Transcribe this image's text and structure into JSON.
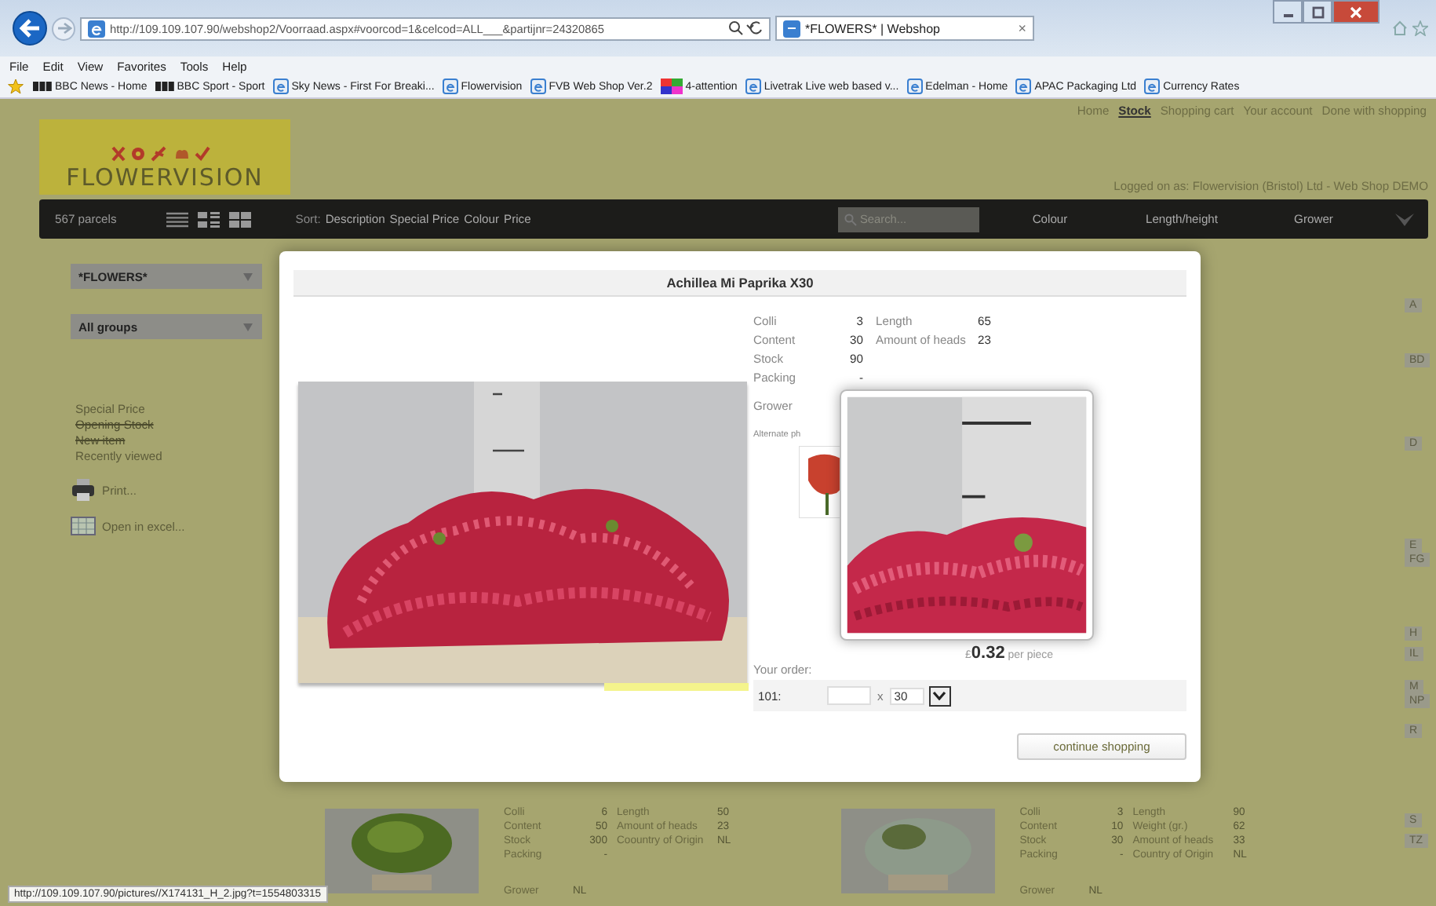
{
  "browser": {
    "address": "http://109.109.107.90/webshop2/Voorraad.aspx#voorcod=1&celcod=ALL___&partijnr=24320865",
    "tab": {
      "title": "*FLOWERS* | Webshop",
      "close": "×"
    },
    "menu": [
      "File",
      "Edit",
      "View",
      "Favorites",
      "Tools",
      "Help"
    ],
    "favorites": [
      {
        "kind": "bbc",
        "label": "BBC News - Home"
      },
      {
        "kind": "bbc",
        "label": "BBC Sport - Sport"
      },
      {
        "kind": "page",
        "label": "Sky News - First For Breaki..."
      },
      {
        "kind": "page",
        "label": "Flowervision"
      },
      {
        "kind": "page",
        "label": "FVB Web Shop Ver.2"
      },
      {
        "kind": "tiles",
        "label": "4-attention"
      },
      {
        "kind": "page",
        "label": "Livetrak  Live web based v..."
      },
      {
        "kind": "page",
        "label": "Edelman - Home"
      },
      {
        "kind": "page",
        "label": "APAC Packaging Ltd"
      },
      {
        "kind": "page",
        "label": "Currency Rates"
      }
    ]
  },
  "nav": [
    {
      "label": "Home",
      "selected": false
    },
    {
      "label": "Stock",
      "selected": true
    },
    {
      "label": "Shopping cart",
      "selected": false
    },
    {
      "label": "Your account",
      "selected": false
    },
    {
      "label": "Done with shopping",
      "selected": false
    }
  ],
  "logo": {
    "text": "FLOWERVISION"
  },
  "logged_on": "Logged on as: Flowervision (Bristol) Ltd - Web Shop DEMO",
  "toolbar": {
    "count": "567 parcels",
    "sort_label": "Sort:",
    "sort_options": [
      "Description",
      "Special Price",
      "Colour",
      "Price"
    ],
    "search_placeholder": "Search...",
    "filters": [
      "Colour",
      "Length/height",
      "Grower"
    ]
  },
  "sidebar": {
    "selects": [
      "*FLOWERS*",
      "All groups"
    ],
    "links": [
      {
        "label": "Special Price",
        "struck": false
      },
      {
        "label": "Opening Stock",
        "struck": true
      },
      {
        "label": "New item",
        "struck": true
      },
      {
        "label": "Recently viewed",
        "struck": false
      }
    ],
    "actions": [
      {
        "kind": "print",
        "label": "Print..."
      },
      {
        "kind": "excel",
        "label": "Open in excel..."
      }
    ]
  },
  "modal": {
    "title": "Achillea Mi Paprika X30",
    "details": [
      {
        "label": "Colli",
        "value": "3",
        "label_2": "Length",
        "value_2": "65"
      },
      {
        "label": "Content",
        "value": "30",
        "label_2": "Amount of heads",
        "value_2": "23"
      },
      {
        "label": "Stock",
        "value": "90"
      },
      {
        "label": "Packing",
        "value": "-"
      }
    ],
    "grower_label": "Grower",
    "alternate_label": "Alternate ph",
    "price": "£**0.32** per piece",
    "order_label": "Your order:",
    "order_row": {
      "label": "101:",
      "times": "x",
      "unit": "30"
    },
    "continue": "continue shopping"
  },
  "cards": [
    {
      "rows": [
        {
          "label": "Colli",
          "value": "6",
          "label_2": "Length",
          "value_2": "50"
        },
        {
          "label": "Content",
          "value": "50",
          "label_2": "Amount of heads",
          "value_2": "23"
        },
        {
          "label": "Stock",
          "value": "300",
          "label_2": "Coountry of Origin",
          "value_2": "NL"
        },
        {
          "label": "Packing",
          "value": "-"
        }
      ],
      "grower_label": "Grower",
      "grower": "NL"
    },
    {
      "rows": [
        {
          "label": "Colli",
          "value": "3",
          "label_2": "Length",
          "value_2": "90"
        },
        {
          "label": "Content",
          "value": "10",
          "label_2": "Weight (gr.)",
          "value_2": "62"
        },
        {
          "label": "Stock",
          "value": "30",
          "label_2": "Amount of heads",
          "value_2": "33"
        },
        {
          "label": "Packing",
          "value": "-",
          "label_2": "Country of Origin",
          "value_2": "NL"
        }
      ],
      "grower_label": "Grower",
      "grower": "NL"
    }
  ],
  "index_tags": [
    "A",
    "BD",
    "D",
    "E",
    "FG",
    "H",
    "IL",
    "M",
    "NP",
    "R",
    "S",
    "TZ"
  ],
  "status_url": "http://109.109.107.90/pictures//X174131_H_2.jpg?t=1554803315"
}
